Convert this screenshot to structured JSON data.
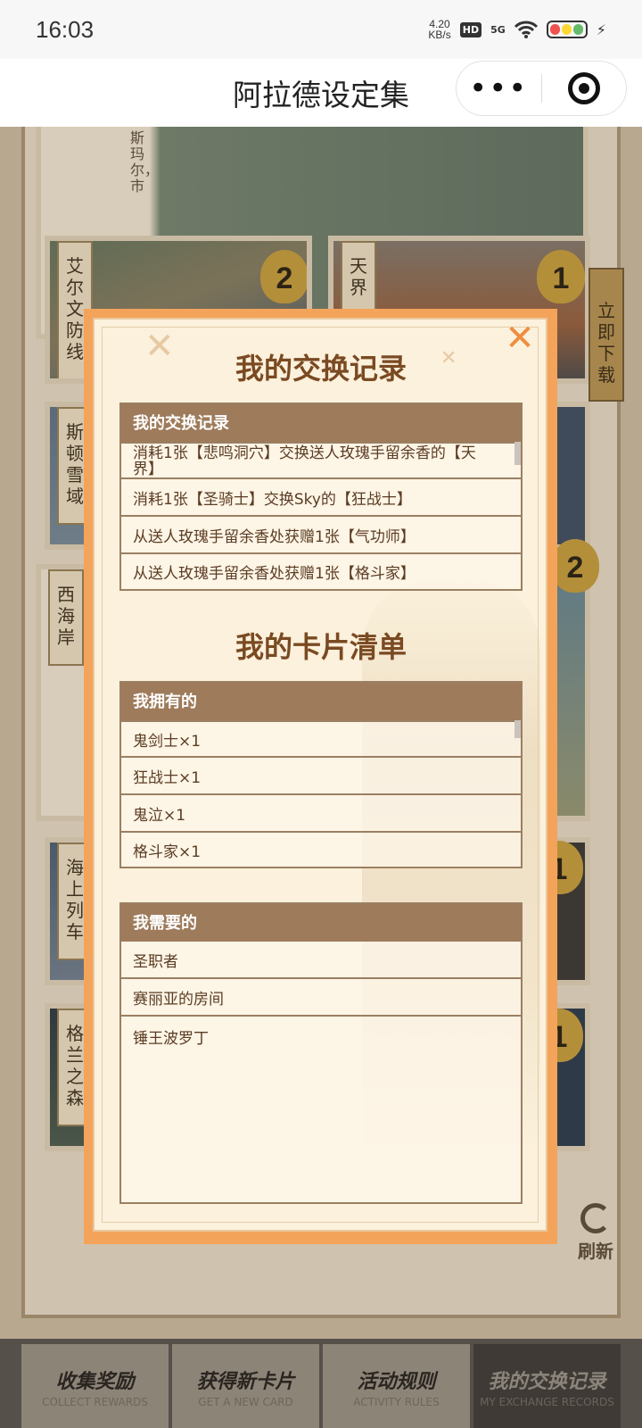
{
  "status_bar": {
    "time": "16:03",
    "net_speed_value": "4.20",
    "net_speed_unit": "KB/s",
    "hd": "HD",
    "signal": "5G"
  },
  "nav": {
    "title": "阿拉德设定集",
    "more_icon": "more-dots-icon",
    "close_icon": "target-close-icon"
  },
  "background": {
    "cards": [
      {
        "label": "斯玛尔，市",
        "badge": ""
      },
      {
        "label": "艾尔文防线",
        "badge": "2"
      },
      {
        "label": "天界",
        "badge": "1"
      },
      {
        "label": "斯顿雪域",
        "badge": ""
      },
      {
        "label": "西海岸",
        "badge": ""
      },
      {
        "label": "",
        "badge": "2"
      },
      {
        "label": "海上列车",
        "badge": ""
      },
      {
        "label": "",
        "badge": "1"
      },
      {
        "label": "格兰之森",
        "badge": ""
      },
      {
        "label": "",
        "badge": "1"
      }
    ],
    "download_tab": "立即下载",
    "refresh_label": "刷新"
  },
  "bottom_tabs": [
    {
      "label": "收集奖励",
      "sub": "COLLECT REWARDS"
    },
    {
      "label": "获得新卡片",
      "sub": "GET A NEW CARD"
    },
    {
      "label": "活动规则",
      "sub": "ACTIVITY RULES"
    },
    {
      "label": "我的交换记录",
      "sub": "MY EXCHANGE RECORDS"
    }
  ],
  "modal": {
    "close_icon": "close-icon",
    "exchange_title": "我的交换记录",
    "exchange_table": {
      "header": "我的交换记录",
      "rows": [
        "消耗1张【悲鸣洞穴】交换送人玫瑰手留余香的【天界】",
        "消耗1张【圣骑士】交换Sky的【狂战士】",
        "从送人玫瑰手留余香处获赠1张【气功师】",
        "从送人玫瑰手留余香处获赠1张【格斗家】"
      ]
    },
    "cards_title": "我的卡片清单",
    "owned_table": {
      "header": "我拥有的",
      "rows": [
        "鬼剑士×1",
        "狂战士×1",
        "鬼泣×1",
        "格斗家×1"
      ]
    },
    "needed_table": {
      "header": "我需要的",
      "rows": [
        "圣职者",
        "赛丽亚的房间",
        "锤王波罗丁"
      ]
    }
  }
}
